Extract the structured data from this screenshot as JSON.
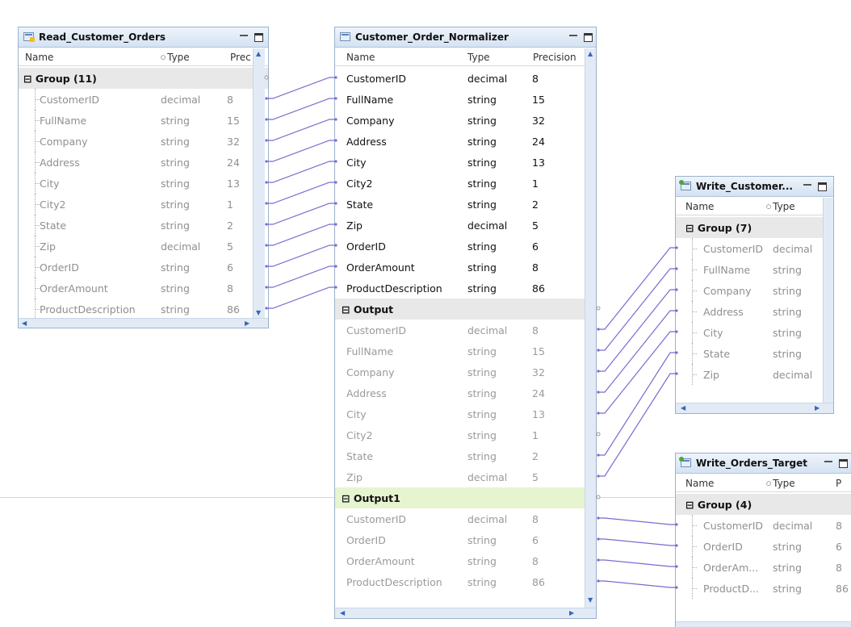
{
  "columns": {
    "name": "Name",
    "type": "Type",
    "precision": "Precision",
    "prec_short": "Prec",
    "p_short": "P"
  },
  "read": {
    "title": "Read_Customer_Orders",
    "group": "Group (11)",
    "fields": [
      {
        "name": "CustomerID",
        "type": "decimal",
        "prec": "8"
      },
      {
        "name": "FullName",
        "type": "string",
        "prec": "15"
      },
      {
        "name": "Company",
        "type": "string",
        "prec": "32"
      },
      {
        "name": "Address",
        "type": "string",
        "prec": "24"
      },
      {
        "name": "City",
        "type": "string",
        "prec": "13"
      },
      {
        "name": "City2",
        "type": "string",
        "prec": "1"
      },
      {
        "name": "State",
        "type": "string",
        "prec": "2"
      },
      {
        "name": "Zip",
        "type": "decimal",
        "prec": "5"
      },
      {
        "name": "OrderID",
        "type": "string",
        "prec": "6"
      },
      {
        "name": "OrderAmount",
        "type": "string",
        "prec": "8"
      },
      {
        "name": "ProductDescription",
        "type": "string",
        "prec": "86"
      }
    ]
  },
  "normalizer": {
    "title": "Customer_Order_Normalizer",
    "inputs": [
      {
        "name": "CustomerID",
        "type": "decimal",
        "prec": "8"
      },
      {
        "name": "FullName",
        "type": "string",
        "prec": "15"
      },
      {
        "name": "Company",
        "type": "string",
        "prec": "32"
      },
      {
        "name": "Address",
        "type": "string",
        "prec": "24"
      },
      {
        "name": "City",
        "type": "string",
        "prec": "13"
      },
      {
        "name": "City2",
        "type": "string",
        "prec": "1"
      },
      {
        "name": "State",
        "type": "string",
        "prec": "2"
      },
      {
        "name": "Zip",
        "type": "decimal",
        "prec": "5"
      },
      {
        "name": "OrderID",
        "type": "string",
        "prec": "6"
      },
      {
        "name": "OrderAmount",
        "type": "string",
        "prec": "8"
      },
      {
        "name": "ProductDescription",
        "type": "string",
        "prec": "86"
      }
    ],
    "output_group": "Output",
    "outputs": [
      {
        "name": "CustomerID",
        "type": "decimal",
        "prec": "8"
      },
      {
        "name": "FullName",
        "type": "string",
        "prec": "15"
      },
      {
        "name": "Company",
        "type": "string",
        "prec": "32"
      },
      {
        "name": "Address",
        "type": "string",
        "prec": "24"
      },
      {
        "name": "City",
        "type": "string",
        "prec": "13"
      },
      {
        "name": "City2",
        "type": "string",
        "prec": "1"
      },
      {
        "name": "State",
        "type": "string",
        "prec": "2"
      },
      {
        "name": "Zip",
        "type": "decimal",
        "prec": "5"
      }
    ],
    "output1_group": "Output1",
    "outputs1": [
      {
        "name": "CustomerID",
        "type": "decimal",
        "prec": "8"
      },
      {
        "name": "OrderID",
        "type": "string",
        "prec": "6"
      },
      {
        "name": "OrderAmount",
        "type": "string",
        "prec": "8"
      },
      {
        "name": "ProductDescription",
        "type": "string",
        "prec": "86"
      }
    ]
  },
  "write_customer": {
    "title": "Write_Customer...",
    "group": "Group (7)",
    "fields": [
      {
        "name": "CustomerID",
        "type": "decimal"
      },
      {
        "name": "FullName",
        "type": "string"
      },
      {
        "name": "Company",
        "type": "string"
      },
      {
        "name": "Address",
        "type": "string"
      },
      {
        "name": "City",
        "type": "string"
      },
      {
        "name": "State",
        "type": "string"
      },
      {
        "name": "Zip",
        "type": "decimal"
      }
    ]
  },
  "write_orders": {
    "title": "Write_Orders_Target",
    "group": "Group (4)",
    "fields": [
      {
        "name": "CustomerID",
        "type": "decimal",
        "prec": "8"
      },
      {
        "name": "OrderID",
        "type": "string",
        "prec": "6"
      },
      {
        "name": "OrderAm...",
        "type": "string",
        "prec": "8"
      },
      {
        "name": "ProductD...",
        "type": "string",
        "prec": "86"
      }
    ]
  },
  "colors": {
    "wire": "#7a6ad0",
    "title_bar": "#d4e2f2",
    "group_bg": "#e8e8e8",
    "output1_bg": "#e6f4d0"
  }
}
